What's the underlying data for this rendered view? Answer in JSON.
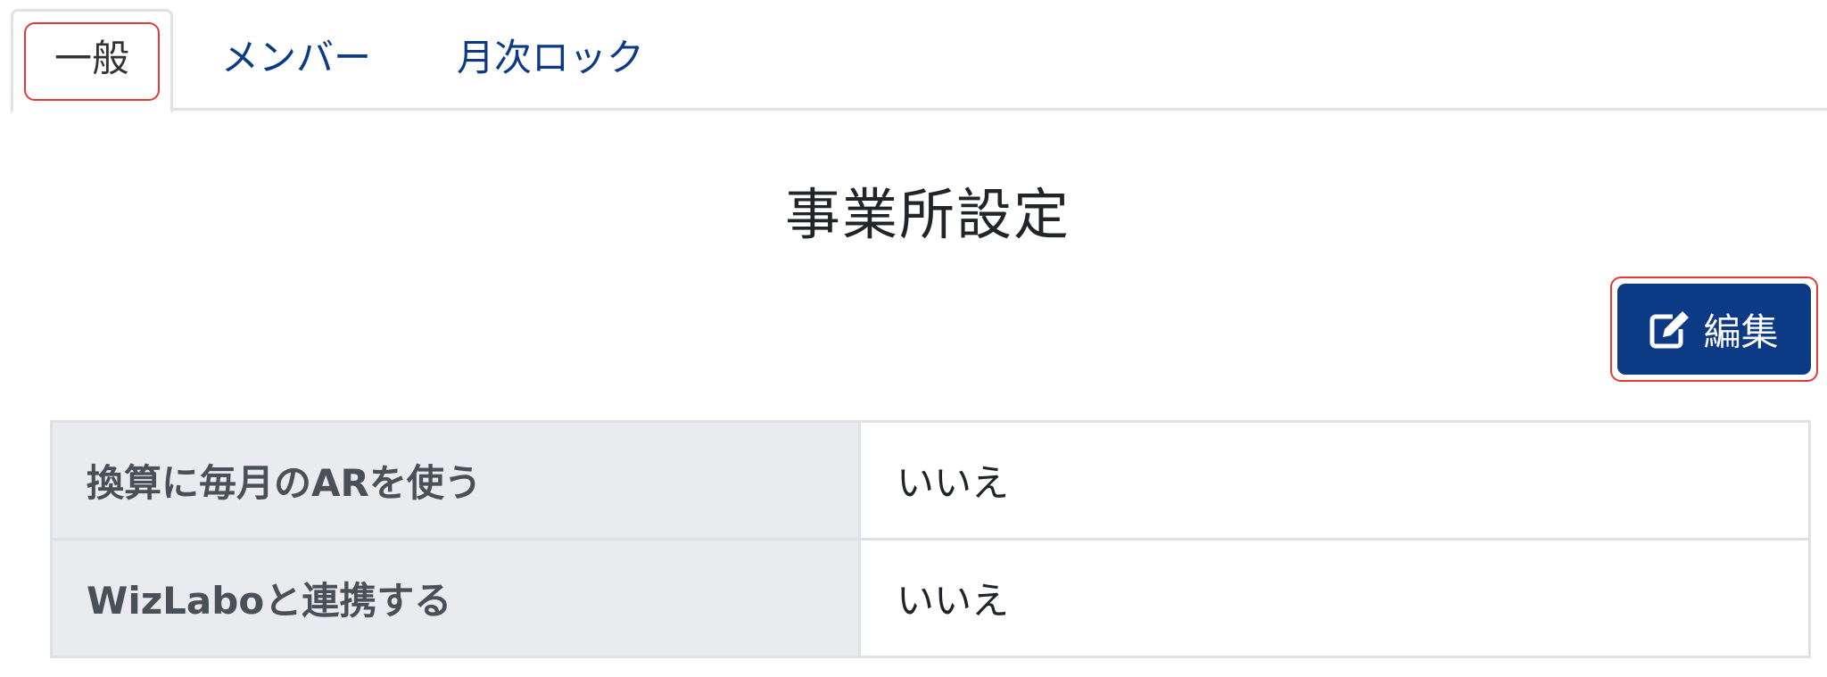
{
  "tabs": [
    {
      "label": "一般",
      "active": true
    },
    {
      "label": "メンバー",
      "active": false
    },
    {
      "label": "月次ロック",
      "active": false
    }
  ],
  "page": {
    "title": "事業所設定"
  },
  "toolbar": {
    "edit_label": "編集",
    "edit_icon": "edit-icon"
  },
  "settings": {
    "rows": [
      {
        "label": "換算に毎月のARを使う",
        "value": "いいえ"
      },
      {
        "label": "WizLaboと連携する",
        "value": "いいえ"
      }
    ]
  },
  "colors": {
    "accent": "#0d3a84",
    "focus_ring": "#e53935",
    "label_bg": "#e9ebee"
  }
}
